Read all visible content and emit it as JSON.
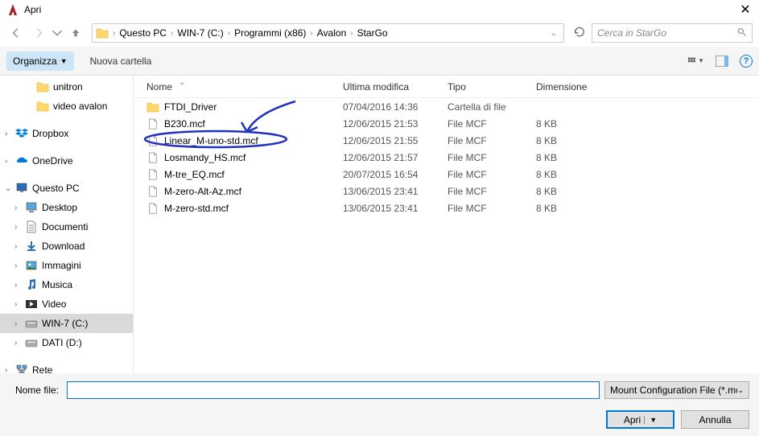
{
  "title": "Apri",
  "breadcrumb": [
    "Questo PC",
    "WIN-7 (C:)",
    "Programmi (x86)",
    "Avalon",
    "StarGo"
  ],
  "search_placeholder": "Cerca in StarGo",
  "toolbar": {
    "organize": "Organizza",
    "new_folder": "Nuova cartella"
  },
  "sidebar": {
    "items": [
      {
        "label": "unitron",
        "icon": "folder",
        "indent": 2,
        "arrow": ""
      },
      {
        "label": "video avalon",
        "icon": "folder",
        "indent": 2,
        "arrow": ""
      },
      {
        "label": "",
        "icon": "",
        "indent": 0,
        "arrow": ""
      },
      {
        "label": "Dropbox",
        "icon": "dropbox",
        "indent": 0,
        "arrow": "›"
      },
      {
        "label": "",
        "icon": "",
        "indent": 0,
        "arrow": ""
      },
      {
        "label": "OneDrive",
        "icon": "onedrive",
        "indent": 0,
        "arrow": "›"
      },
      {
        "label": "",
        "icon": "",
        "indent": 0,
        "arrow": ""
      },
      {
        "label": "Questo PC",
        "icon": "pc",
        "indent": 0,
        "arrow": "⌄"
      },
      {
        "label": "Desktop",
        "icon": "desktop",
        "indent": 1,
        "arrow": "›"
      },
      {
        "label": "Documenti",
        "icon": "documents",
        "indent": 1,
        "arrow": "›"
      },
      {
        "label": "Download",
        "icon": "download",
        "indent": 1,
        "arrow": "›"
      },
      {
        "label": "Immagini",
        "icon": "images",
        "indent": 1,
        "arrow": "›"
      },
      {
        "label": "Musica",
        "icon": "music",
        "indent": 1,
        "arrow": "›"
      },
      {
        "label": "Video",
        "icon": "video",
        "indent": 1,
        "arrow": "›"
      },
      {
        "label": "WIN-7 (C:)",
        "icon": "disk",
        "indent": 1,
        "arrow": "›",
        "sel": true
      },
      {
        "label": "DATI (D:)",
        "icon": "disk",
        "indent": 1,
        "arrow": "›"
      },
      {
        "label": "",
        "icon": "",
        "indent": 0,
        "arrow": ""
      },
      {
        "label": "Rete",
        "icon": "network",
        "indent": 0,
        "arrow": "›"
      }
    ]
  },
  "columns": {
    "name": "Nome",
    "modified": "Ultima modifica",
    "type": "Tipo",
    "size": "Dimensione"
  },
  "files": [
    {
      "name": "FTDI_Driver",
      "modified": "07/04/2016 14:36",
      "type": "Cartella di file",
      "size": "",
      "icon": "folder"
    },
    {
      "name": "B230.mcf",
      "modified": "12/06/2015 21:53",
      "type": "File MCF",
      "size": "8 KB",
      "icon": "file"
    },
    {
      "name": "Linear_M-uno-std.mcf",
      "modified": "12/06/2015 21:55",
      "type": "File MCF",
      "size": "8 KB",
      "icon": "file"
    },
    {
      "name": "Losmandy_HS.mcf",
      "modified": "12/06/2015 21:57",
      "type": "File MCF",
      "size": "8 KB",
      "icon": "file"
    },
    {
      "name": "M-tre_EQ.mcf",
      "modified": "20/07/2015 16:54",
      "type": "File MCF",
      "size": "8 KB",
      "icon": "file"
    },
    {
      "name": "M-zero-Alt-Az.mcf",
      "modified": "13/06/2015 23:41",
      "type": "File MCF",
      "size": "8 KB",
      "icon": "file"
    },
    {
      "name": "M-zero-std.mcf",
      "modified": "13/06/2015 23:41",
      "type": "File MCF",
      "size": "8 KB",
      "icon": "file"
    }
  ],
  "filename_label": "Nome file:",
  "filename_value": "",
  "filetype": "Mount Configuration File (*.mc",
  "btn_open": "Apri",
  "btn_cancel": "Annulla"
}
